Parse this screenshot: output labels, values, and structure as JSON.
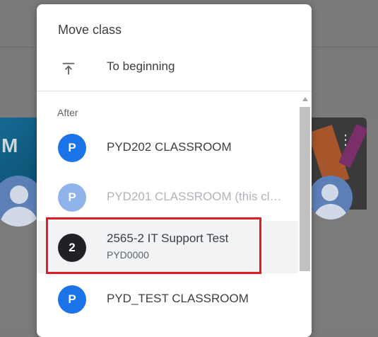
{
  "background": {
    "left_card_mark": "M"
  },
  "dialog": {
    "title": "Move class",
    "to_beginning": {
      "label": "To beginning",
      "icon": "vertical-align-top-icon"
    },
    "section_label": "After",
    "items": [
      {
        "initial": "P",
        "name": "PYD202 CLASSROOM",
        "subtitle": "",
        "color": "#1a73e8",
        "disabled": false,
        "selected": false
      },
      {
        "initial": "P",
        "name": "PYD201 CLASSROOM (this class)",
        "subtitle": "",
        "color": "#8fb4ec",
        "disabled": true,
        "selected": false
      },
      {
        "initial": "2",
        "name": "2565-2 IT Support Test",
        "subtitle": "PYD0000",
        "color": "#202124",
        "disabled": false,
        "selected": true
      },
      {
        "initial": "P",
        "name": "PYD_TEST CLASSROOM",
        "subtitle": "",
        "color": "#1a73e8",
        "disabled": false,
        "selected": false
      }
    ]
  },
  "colors": {
    "highlight_border": "#e01b24",
    "overlay": "#7a7a7a"
  }
}
